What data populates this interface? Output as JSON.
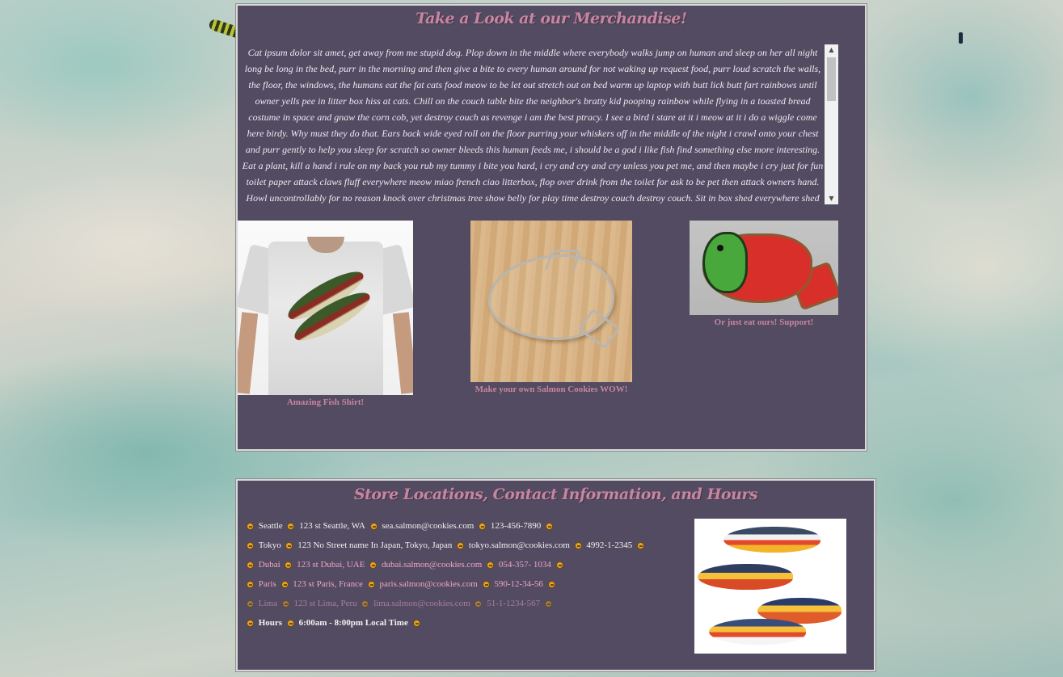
{
  "merch": {
    "heading": "Take a Look at our Merchandise!",
    "description": "Cat ipsum dolor sit amet, get away from me stupid dog. Plop down in the middle where everybody walks jump on human and sleep on her all night long be long in the bed, purr in the morning and then give a bite to every human around for not waking up request food, purr loud scratch the walls, the floor, the windows, the humans eat the fat cats food meow to be let out stretch out on bed warm up laptop with butt lick butt fart rainbows until owner yells pee in litter box hiss at cats. Chill on the couch table bite the neighbor's bratty kid pooping rainbow while flying in a toasted bread costume in space and gnaw the corn cob, yet destroy couch as revenge i am the best ptracy. I see a bird i stare at it i meow at it i do a wiggle come here birdy. Why must they do that. Ears back wide eyed roll on the floor purring your whiskers off in the middle of the night i crawl onto your chest and purr gently to help you sleep for scratch so owner bleeds this human feeds me, i should be a god i like fish find something else more interesting. Eat a plant, kill a hand i rule on my back you rub my tummy i bite you hard, i cry and cry and cry unless you pet me, and then maybe i cry just for fun toilet paper attack claws fluff everywhere meow miao french ciao litterbox, flop over drink from the toilet for ask to be pet then attack owners hand. Howl uncontrollably for no reason knock over christmas tree show belly for play time destroy couch destroy couch. Sit in box shed everywhere shed",
    "products": [
      {
        "caption": "Amazing Fish Shirt!"
      },
      {
        "caption": "Make your own Salmon Cookies WOW!"
      },
      {
        "caption": "Or just eat ours! Support!"
      }
    ]
  },
  "stores": {
    "heading": "Store Locations, Contact Information, and Hours",
    "locations": [
      {
        "city": "Seattle",
        "address": "123 st Seattle, WA",
        "email": "sea.salmon@cookies.com",
        "phone": "123-456-7890"
      },
      {
        "city": "Tokyo",
        "address": "123 No Street name In Japan, Tokyo, Japan",
        "email": "tokyo.salmon@cookies.com",
        "phone": "4992-1-2345"
      },
      {
        "city": "Dubai",
        "address": "123 st Dubai, UAE",
        "email": "dubai.salmon@cookies.com",
        "phone": "054-357- 1034"
      },
      {
        "city": "Paris",
        "address": "123 st Paris, France",
        "email": "paris.salmon@cookies.com",
        "phone": "590-12-34-56"
      },
      {
        "city": "Lima",
        "address": "123 st Lima, Peru",
        "email": "lima.salmon@cookies.com",
        "phone": "51-1-1234-567"
      }
    ],
    "hours_label": "Hours",
    "hours_value": "6:00am - 8:00pm Local Time"
  },
  "colors": {
    "panel": "#524b61",
    "heading": "#c9859f",
    "accent_row": "#f1a6c5",
    "bullet": "#e9a127"
  }
}
